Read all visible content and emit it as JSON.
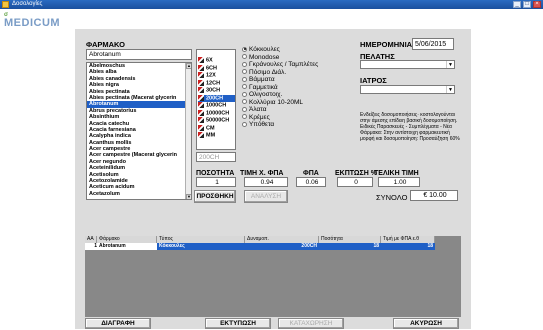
{
  "window": {
    "title": "Δοσολογίες",
    "min": "_",
    "max": "□",
    "close": "×",
    "close_color": "#d9534f"
  },
  "logo": {
    "text": "MEDICUM",
    "prefix": "σ"
  },
  "farmako": {
    "label": "ΦΑΡΜΑΚΟ",
    "value": "Abrotanum",
    "items": [
      "Abelmoschus",
      "Abies alba",
      "Abies canadensis",
      "Abies nigra",
      "Abies pectinata",
      "Abies pectinata (Macerat glycerin",
      "Abrotanum",
      "Abrus precatorius",
      "Absinthium",
      "Acacia catechu",
      "Acacia farnesiana",
      "Acalypha indica",
      "Acanthus mollis",
      "Acer campestre",
      "Acer campestre (Macerat glycerin",
      "Acer negundo",
      "Aceteinilidum",
      "Acetisolum",
      "Acetozolamide",
      "Aceticum acidum",
      "Acetazolum"
    ],
    "selected_index": 6
  },
  "potencies": {
    "items": [
      "6X",
      "6CH",
      "12X",
      "12CH",
      "30CH",
      "200CH",
      "1000CH",
      "10000CH",
      "50000CH",
      "CM",
      "MM"
    ],
    "selected_index": 5,
    "current": "200CH"
  },
  "forms": {
    "items": [
      "Κόκκουλες",
      "Monodose",
      "Γκράνουλες / Ταμπλέτες",
      "Πόσιμο Διάλ.",
      "Βάμματα",
      "Γαμμετικά",
      "Ολιγοστοιχ.",
      "Κολλύρια 10-20ML",
      "Άλατα",
      "Κρέμες",
      "Υπόθετα"
    ],
    "selected_index": 0
  },
  "right": {
    "date_label": "ΗΜΕΡΟΜΗΝΙΑ",
    "date_value": "5/06/2015",
    "client_label": "ΠΕΛΑΤΗΣ",
    "doctor_label": "ΙΑΤΡΟΣ",
    "note": "Ενδείξεις δοσομοποιήσεις· κοστολογούνται στην άμεσης επίδειη βασική δοσομοποίηση. Ειδικές Παρασκευές - Συμπλέγματα - Νέα Φάρμακα: Στην αντίστοιχη φαρμακευτική μορφή και δοσομοποίηση: Προσαύξηση 60%"
  },
  "fields": {
    "qty_label": "ΠΟΣΟΤΗΤΑ",
    "qty_value": "1",
    "price_label": "ΤΙΜΗ Χ. ΦΠΑ",
    "price_value": "0.94",
    "vat_label": "ΦΠΑ",
    "vat_value": "0.06",
    "disc_label": "ΕΚΠΤΩΣΗ %",
    "disc_value": "0",
    "final_label": "ΤΕΛΙΚΗ ΤΙΜΗ",
    "final_value": "1.00"
  },
  "buttons": {
    "add": "ΠΡΟΣΘΗΚΗ",
    "analysis": "ΑΝΑΛΥΣΗ",
    "delete": "ΔΙΑΓΡΑΦΗ",
    "print": "ΕΚΤΥΠΩΣΗ",
    "save": "ΚΑΤΑΧΩΡΗΣΗ",
    "cancel": "ΑΚΥΡΩΣΗ"
  },
  "total": {
    "label": "ΣΥΝΟΛΟ",
    "value": "€ 10.00"
  },
  "grid": {
    "headers": [
      "ΑΑ",
      "Φάρμακο",
      "Τύπος",
      "Δυναμοπ.",
      "Ποσότητα",
      "Τιμή με ΦΠΑ ε.θ"
    ],
    "rows": [
      [
        "1",
        "Abrotanum",
        "Κόκκουλες",
        "200CH",
        "18",
        "18"
      ]
    ]
  }
}
